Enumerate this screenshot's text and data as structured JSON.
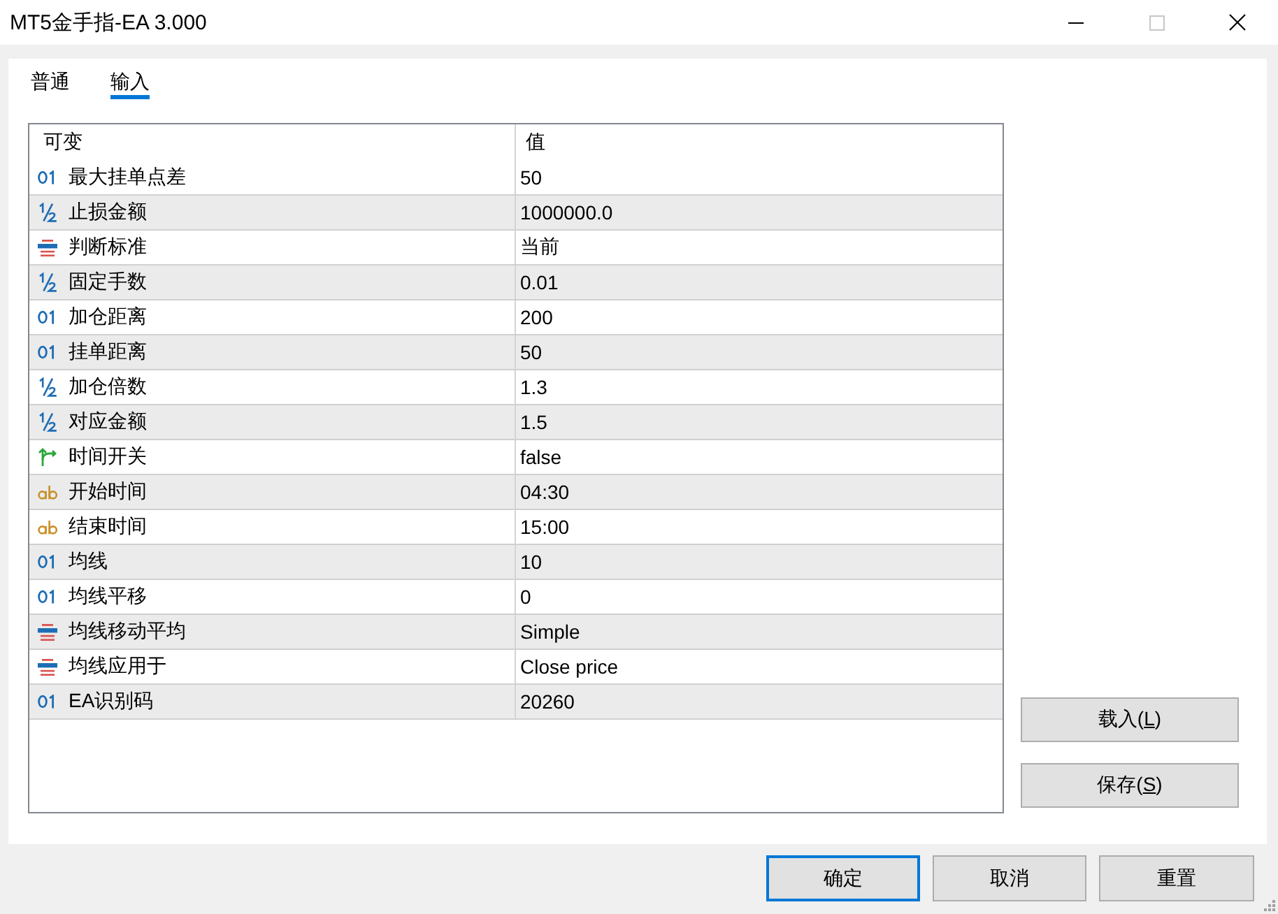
{
  "window": {
    "title": "MT5金手指-EA 3.000",
    "controls": [
      {
        "kind": "minimize",
        "disabled": false
      },
      {
        "kind": "maximize",
        "disabled": true
      },
      {
        "kind": "close",
        "disabled": false
      }
    ]
  },
  "tabs": [
    {
      "label": "普通",
      "selected": false
    },
    {
      "label": "输入",
      "selected": true
    }
  ],
  "table": {
    "columns": [
      "可变",
      "值"
    ],
    "rows": [
      {
        "kind": "int",
        "name": "最大挂单点差",
        "value": "50"
      },
      {
        "kind": "double",
        "name": "止损金额",
        "value": "1000000.0"
      },
      {
        "kind": "enum",
        "name": "判断标准",
        "value": "当前"
      },
      {
        "kind": "double",
        "name": "固定手数",
        "value": "0.01"
      },
      {
        "kind": "int",
        "name": "加仓距离",
        "value": "200"
      },
      {
        "kind": "int",
        "name": "挂单距离",
        "value": "50"
      },
      {
        "kind": "double",
        "name": "加仓倍数",
        "value": "1.3"
      },
      {
        "kind": "double",
        "name": "对应金额",
        "value": "1.5"
      },
      {
        "kind": "bool",
        "name": "时间开关",
        "value": "false"
      },
      {
        "kind": "string",
        "name": "开始时间",
        "value": "04:30"
      },
      {
        "kind": "string",
        "name": "结束时间",
        "value": "15:00"
      },
      {
        "kind": "int",
        "name": "均线",
        "value": "10"
      },
      {
        "kind": "int",
        "name": "均线平移",
        "value": "0"
      },
      {
        "kind": "enum",
        "name": "均线移动平均",
        "value": "Simple"
      },
      {
        "kind": "enum",
        "name": "均线应用于",
        "value": "Close price"
      },
      {
        "kind": "int",
        "name": "EA识别码",
        "value": "20260"
      }
    ]
  },
  "side_buttons": [
    {
      "before": "载入(",
      "key": "L",
      "after": ")"
    },
    {
      "before": "保存(",
      "key": "S",
      "after": ")"
    }
  ],
  "footer_buttons": [
    {
      "label": "确定",
      "focused": true
    },
    {
      "label": "取消",
      "focused": false
    },
    {
      "label": "重置",
      "focused": false
    }
  ]
}
